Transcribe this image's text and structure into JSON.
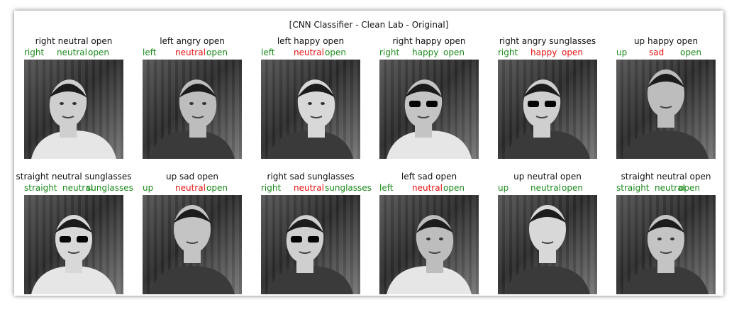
{
  "title": "[CNN Classifier - Clean Lab - Original]",
  "colors": {
    "correct": "#1a8a1a",
    "incorrect": "#e81010"
  },
  "cells": [
    {
      "truth": "right neutral open",
      "pred": [
        {
          "t": "right",
          "ok": true
        },
        {
          "t": "neutral",
          "ok": true
        },
        {
          "t": "open",
          "ok": true
        }
      ],
      "pose": "right",
      "glasses": false
    },
    {
      "truth": "left angry open",
      "pred": [
        {
          "t": "left",
          "ok": true
        },
        {
          "t": "neutral",
          "ok": false
        },
        {
          "t": "open",
          "ok": true
        }
      ],
      "pose": "left",
      "glasses": false
    },
    {
      "truth": "left happy open",
      "pred": [
        {
          "t": "left",
          "ok": true
        },
        {
          "t": "neutral",
          "ok": false
        },
        {
          "t": "open",
          "ok": true
        }
      ],
      "pose": "left",
      "glasses": false
    },
    {
      "truth": "right happy open",
      "pred": [
        {
          "t": "right",
          "ok": true
        },
        {
          "t": "happy",
          "ok": true
        },
        {
          "t": "open",
          "ok": true
        }
      ],
      "pose": "right",
      "glasses": true
    },
    {
      "truth": "right angry sunglasses",
      "pred": [
        {
          "t": "right",
          "ok": true
        },
        {
          "t": "happy",
          "ok": false
        },
        {
          "t": "open",
          "ok": false
        }
      ],
      "pose": "right",
      "glasses": true
    },
    {
      "truth": "up happy open",
      "pred": [
        {
          "t": "up",
          "ok": true
        },
        {
          "t": "sad",
          "ok": false
        },
        {
          "t": "open",
          "ok": true
        }
      ],
      "pose": "up",
      "glasses": false
    },
    {
      "truth": "straight neutral sunglasses",
      "pred": [
        {
          "t": "straight",
          "ok": true
        },
        {
          "t": "neutral",
          "ok": true
        },
        {
          "t": "sunglasses",
          "ok": true
        }
      ],
      "pose": "straight",
      "glasses": true
    },
    {
      "truth": "up sad open",
      "pred": [
        {
          "t": "up",
          "ok": true
        },
        {
          "t": "neutral",
          "ok": false
        },
        {
          "t": "open",
          "ok": true
        }
      ],
      "pose": "up",
      "glasses": false
    },
    {
      "truth": "right sad sunglasses",
      "pred": [
        {
          "t": "right",
          "ok": true
        },
        {
          "t": "neutral",
          "ok": false
        },
        {
          "t": "sunglasses",
          "ok": true
        }
      ],
      "pose": "right",
      "glasses": true
    },
    {
      "truth": "left sad open",
      "pred": [
        {
          "t": "left",
          "ok": true
        },
        {
          "t": "neutral",
          "ok": false
        },
        {
          "t": "open",
          "ok": true
        }
      ],
      "pose": "left",
      "glasses": false
    },
    {
      "truth": "up neutral open",
      "pred": [
        {
          "t": "up",
          "ok": true
        },
        {
          "t": "neutral",
          "ok": true
        },
        {
          "t": "open",
          "ok": true
        }
      ],
      "pose": "up",
      "glasses": false
    },
    {
      "truth": "straight neutral open",
      "pred": [
        {
          "t": "straight",
          "ok": true
        },
        {
          "t": "neutral",
          "ok": true
        },
        {
          "t": "open",
          "ok": true
        }
      ],
      "pose": "straight",
      "glasses": false
    }
  ]
}
